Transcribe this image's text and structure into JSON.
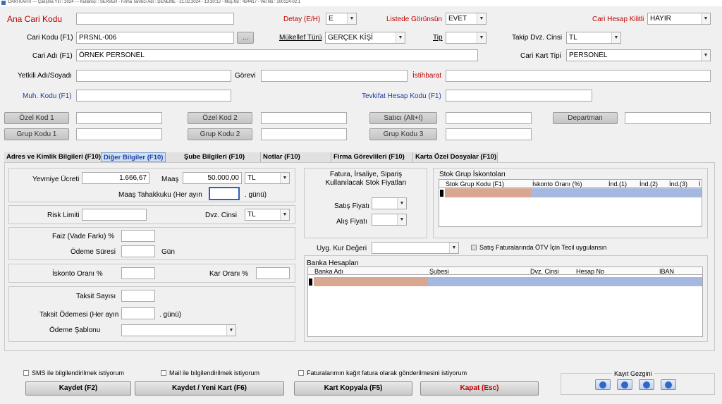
{
  "titlebar": "CARİ KARTI  ---  Çalışma Yılı : 2024  ---  Kullanıcı : SERVER - Firma Tanıtıcı Adı : DENEME - 21.02.2024 - 13:30:12  -  Müş.No : 424417  - Ver.No : 100124-02.1",
  "top": {
    "ana_cari_kodu_label": "Ana Cari Kodu",
    "detay_label": "Detay (E/H)",
    "detay_value": "E",
    "listede_label": "Listede Görünsün",
    "listede_value": "EVET",
    "kilitli_label": "Cari Hesap Kilitli",
    "kilitli_value": "HAYIR",
    "cari_kodu_label": "Cari Kodu (F1)",
    "cari_kodu_value": "PRSNL-006",
    "browse_label": "...",
    "mukellef_label": "Mükellef Türü",
    "mukellef_value": "GERÇEK KİŞİ",
    "tip_label": "Tip",
    "tip_value": "",
    "takip_label": "Takip Dvz. Cinsi",
    "takip_value": "TL",
    "cari_adi_label": "Cari Adı (F1)",
    "cari_adi_value": "ÖRNEK PERSONEL",
    "kart_tipi_label": "Cari Kart Tipi",
    "kart_tipi_value": "PERSONEL",
    "yetkili_label": "Yetkili Adı/Soyadı",
    "gorevi_label": "Görevi",
    "istihbarat_label": "İstihbarat",
    "muh_label": "Muh. Kodu (F1)",
    "tevkifat_label": "Tevkifat Hesap Kodu (F1)",
    "ozel_kod1": "Özel Kod 1",
    "ozel_kod2": "Özel Kod 2",
    "satici": "Satıcı (Alt+I)",
    "departman": "Departman",
    "grup_kodu1": "Grup Kodu 1",
    "grup_kodu2": "Grup Kodu 2",
    "grup_kodu3": "Grup Kodu 3"
  },
  "tabs": [
    "Adres ve Kimlik Bilgileri (F10)",
    "Diğer Bilgiler (F10)",
    "Şube Bilgileri (F10)",
    "Notlar (F10)",
    "Firma Görevlileri  (F10)",
    "Karta Özel Dosyalar (F10)"
  ],
  "left": {
    "yevmiye_label": "Yevmiye Ücreti",
    "yevmiye_value": "1.666,67",
    "maas_label": "Maaş",
    "maas_value": "50.000,00",
    "maas_cur": "TL",
    "tahakkuk_label": "Maaş Tahakkuku (Her ayın",
    "tahakkuk_suffix": ". günü)",
    "risk_label": "Risk Limiti",
    "dvz_label": "Dvz. Cinsi",
    "dvz_value": "TL",
    "faiz_label": "Faiz (Vade Farkı) %",
    "odeme_label": "Ödeme Süresi",
    "gun_label": "Gün",
    "iskonto_label": "İskonto Oranı %",
    "kar_label": "Kar Oranı %",
    "taksit_sayisi_label": "Taksit Sayısı",
    "taksit_odemesi_label": "Taksit Ödemesi (Her ayın",
    "taksit_suffix": ". günü)",
    "odeme_sablonu_label": "Ödeme Şablonu"
  },
  "middle": {
    "fiyat_title": "Fatura, İrsaliye, Sipariş Kullanılacak Stok Fiyatları",
    "satis_label": "Satış Fiyatı",
    "alis_label": "Alış Fiyatı",
    "kur_label": "Uyg. Kur Değeri",
    "otv_label": "Satış Faturalarında ÖTV İçin Tecil uygulansın"
  },
  "stok_grup": {
    "title": "Stok Grup İskontoları",
    "columns": [
      "Stok Grup Kodu (F1)",
      "İskonto Oranı (%)",
      "İnd.(1)",
      "İnd.(2)",
      "İnd.(3)",
      "İ"
    ]
  },
  "banka": {
    "title": "Banka Hesapları",
    "columns": [
      "Banka Adı",
      "Şubesi",
      "Dvz. Cinsi",
      "Hesap No",
      "IBAN"
    ]
  },
  "checks": {
    "sms": "SMS ile bilgilendirilmek istiyorum",
    "mail": "Mail ile bilgilendirilmek istiyorum",
    "kagit": "Faturalarımın kağıt fatura olarak gönderilmesini istiyorum"
  },
  "buttons": {
    "kaydet": "Kaydet (F2)",
    "kaydet_yeni": "Kaydet / Yeni Kart (F6)",
    "kopyala": "Kart Kopyala (F5)",
    "kapat": "Kapat (Esc)"
  },
  "kayit_gezgini": "Kayıt Gezgini"
}
